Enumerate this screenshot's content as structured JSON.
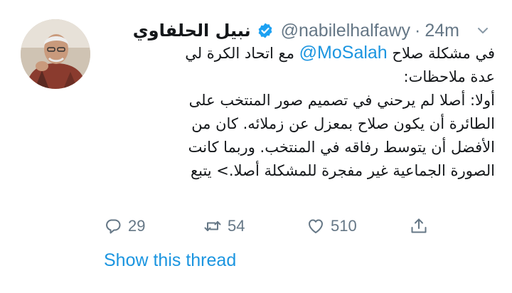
{
  "tweet": {
    "author_name": "نبيل الحلفاوي",
    "handle": "@nabilelhalfawy",
    "separator": "·",
    "time": "24m",
    "icons": {
      "verified": "verified-badge-icon",
      "menu": "chevron-down-icon"
    },
    "colors": {
      "link": "#1b95e0",
      "muted": "#657786",
      "text": "#14171a"
    },
    "body": {
      "line1_before": "في مشكلة صلاح ",
      "mention": "@MoSalah",
      "line1_after": " مع اتحاد الكرة لي",
      "line2": "عدة ملاحظات:",
      "line3": "أولا: أصلا لم يرحني في تصميم صور المنتخب على",
      "line4": "الطائرة أن يكون صلاح بمعزل عن زملائه. كان من",
      "line5": "الأفضل أن يتوسط رفاقه في المنتخب. وربما كانت",
      "line6": "الصورة الجماعية غير مفجرة للمشكلة أصلا.> يتبع"
    },
    "actions": {
      "replies": "29",
      "retweets": "54",
      "likes": "510"
    },
    "show_thread": "Show this thread"
  }
}
